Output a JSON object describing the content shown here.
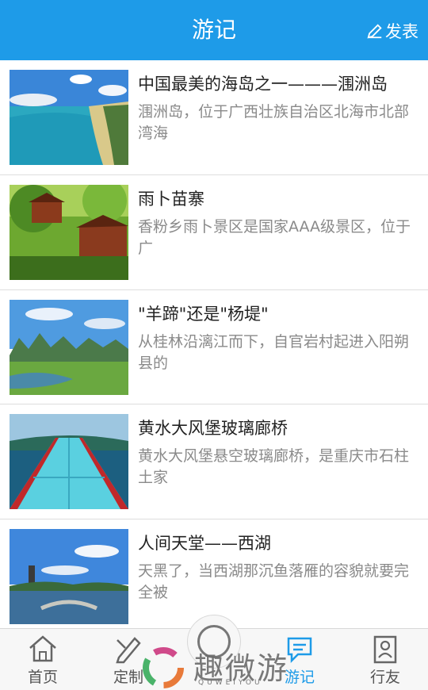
{
  "header": {
    "title": "游记",
    "publish_label": "发表",
    "background_color": "#1e9be8"
  },
  "articles": [
    {
      "title": "中国最美的海岛之一———涠洲岛",
      "description": "涠洲岛，位于广西壮族自治区北海市北部湾海",
      "image": "island-beach-photo"
    },
    {
      "title": "雨卜苗寨",
      "description": "香粉乡雨卜景区是国家AAA级景区，位于广",
      "image": "miao-village-photo"
    },
    {
      "title": "\"羊蹄\"还是\"杨堤\"",
      "description": "从桂林沿漓江而下，自官岩村起进入阳朔县的",
      "image": "karst-river-photo"
    },
    {
      "title": "黄水大风堡玻璃廊桥",
      "description": "黄水大风堡悬空玻璃廊桥，是重庆市石柱土家",
      "image": "glass-bridge-photo"
    },
    {
      "title": "人间天堂——西湖",
      "description": "天黑了，当西湖那沉鱼落雁的容貌就要完全被",
      "image": "west-lake-photo"
    }
  ],
  "tabbar": {
    "tabs": [
      {
        "label": "首页",
        "icon": "home-icon",
        "active": false
      },
      {
        "label": "定制",
        "icon": "customize-icon",
        "active": false
      },
      {
        "label": "",
        "icon": "center-circle-icon",
        "active": false
      },
      {
        "label": "游记",
        "icon": "travel-notes-icon",
        "active": true
      },
      {
        "label": "行友",
        "icon": "friends-icon",
        "active": false
      }
    ],
    "active_color": "#1e9be8"
  },
  "watermark": {
    "text": "趣微游",
    "subtext": "QUWEIYOU"
  }
}
